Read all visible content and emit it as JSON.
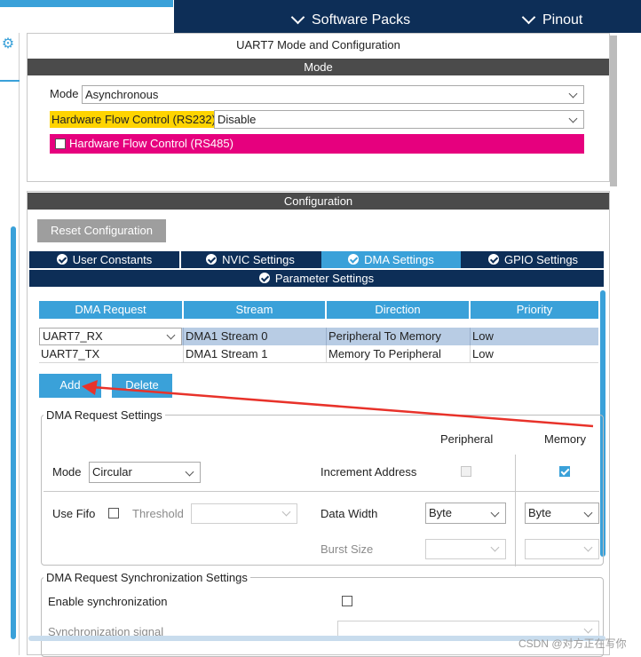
{
  "top_nav": {
    "software_packs": "Software Packs",
    "pinout": "Pinout"
  },
  "panel_title": "UART7 Mode and Configuration",
  "mode_section": {
    "header": "Mode",
    "mode_label": "Mode",
    "mode_value": "Asynchronous",
    "rs232_label": "Hardware Flow Control (RS232)",
    "rs232_value": "Disable",
    "rs485_label": "Hardware Flow Control (RS485)",
    "rs485_checked": false
  },
  "config_section": {
    "header": "Configuration",
    "reset_button": "Reset Configuration",
    "tabs": [
      {
        "label": "User Constants",
        "active": false
      },
      {
        "label": "NVIC Settings",
        "active": false
      },
      {
        "label": "DMA Settings",
        "active": true
      },
      {
        "label": "GPIO Settings",
        "active": false
      }
    ],
    "param_tab": "Parameter Settings"
  },
  "dma_table": {
    "headers": [
      "DMA Request",
      "Stream",
      "Direction",
      "Priority"
    ],
    "rows": [
      {
        "request": "UART7_RX",
        "stream": "DMA1 Stream 0",
        "direction": "Peripheral To Memory",
        "priority": "Low",
        "selected": true
      },
      {
        "request": "UART7_TX",
        "stream": "DMA1 Stream 1",
        "direction": "Memory To Peripheral",
        "priority": "Low",
        "selected": false
      }
    ]
  },
  "buttons": {
    "add": "Add",
    "delete": "Delete"
  },
  "dma_request_settings": {
    "legend": "DMA Request Settings",
    "peripheral_col": "Peripheral",
    "memory_col": "Memory",
    "mode_label": "Mode",
    "mode_value": "Circular",
    "increment_label": "Increment Address",
    "increment_peripheral": false,
    "increment_memory": true,
    "use_fifo_label": "Use Fifo",
    "use_fifo_checked": false,
    "threshold_label": "Threshold",
    "threshold_value": "",
    "data_width_label": "Data Width",
    "data_width_peripheral": "Byte",
    "data_width_memory": "Byte",
    "burst_size_label": "Burst Size",
    "burst_peripheral": "",
    "burst_memory": ""
  },
  "sync_settings": {
    "legend": "DMA Request Synchronization Settings",
    "enable_label": "Enable synchronization",
    "enable_checked": false,
    "signal_label": "Synchronization signal",
    "signal_value": ""
  },
  "watermark": "CSDN @对方正在写你",
  "colors": {
    "accent_blue": "#3aa1d9",
    "navy": "#0d2e57",
    "header_grey": "#4b4b4b",
    "rs232_yellow": "#ffd400",
    "rs485_magenta": "#e6007e",
    "arrow_red": "#e8322a"
  }
}
